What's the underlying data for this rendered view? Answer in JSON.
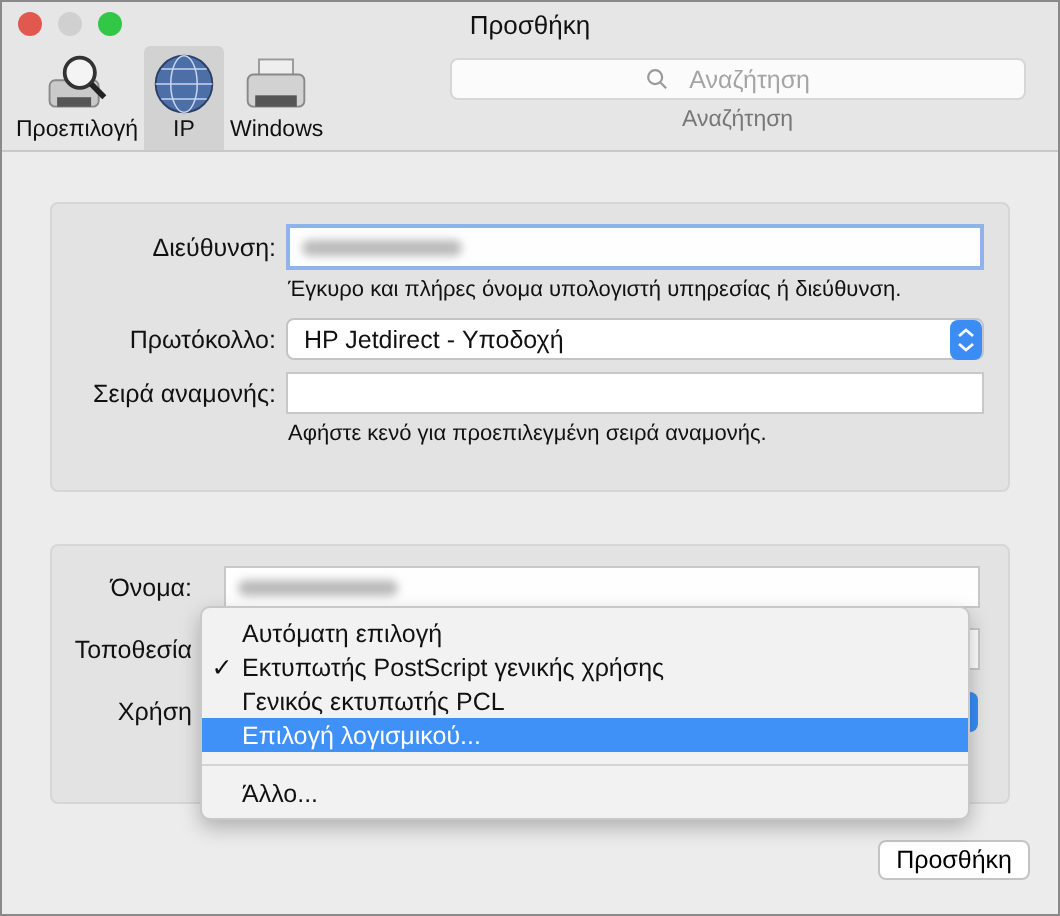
{
  "window": {
    "title": "Προσθήκη"
  },
  "toolbar": {
    "tabs": [
      {
        "label": "Προεπιλογή",
        "kind": "default",
        "selected": false
      },
      {
        "label": "IP",
        "kind": "ip",
        "selected": true
      },
      {
        "label": "Windows",
        "kind": "windows",
        "selected": false
      }
    ],
    "search": {
      "placeholder": "Αναζήτηση",
      "label": "Αναζήτηση"
    }
  },
  "connection": {
    "rows": [
      {
        "kind": "field",
        "label": "Διεύθυνση:",
        "focused": true,
        "value_blurred": true,
        "hint": "Έγκυρο και πλήρες όνομα υπολογιστή υπηρεσίας ή διεύθυνση."
      },
      {
        "kind": "select",
        "label": "Πρωτόκολλο:",
        "value": "HP Jetdirect - Υποδοχή"
      },
      {
        "kind": "field",
        "label": "Σειρά αναμονής:",
        "focused": false,
        "value_blurred": false,
        "hint": "Αφήστε κενό για προεπιλεγμένη σειρά αναμονής."
      }
    ]
  },
  "printer": {
    "rows": [
      {
        "kind": "field",
        "label": "Όνομα:",
        "focused": false,
        "value_blurred": true
      },
      {
        "kind": "field",
        "label": "Τοποθεσία",
        "focused": false
      },
      {
        "kind": "select",
        "label": "Χρήση"
      }
    ]
  },
  "use_menu": {
    "items": [
      {
        "kind": "item",
        "label": "Αυτόματη επιλογή",
        "checked": false,
        "selected": false
      },
      {
        "kind": "item",
        "label": "Εκτυπωτής PostScript γενικής χρήσης",
        "checked": true,
        "selected": false
      },
      {
        "kind": "item",
        "label": "Γενικός εκτυπωτής PCL",
        "checked": false,
        "selected": false
      },
      {
        "kind": "item",
        "label": "Επιλογή λογισμικού...",
        "checked": false,
        "selected": true
      },
      {
        "kind": "separator"
      },
      {
        "kind": "item",
        "label": "Άλλο...",
        "checked": false,
        "selected": false
      }
    ],
    "check_mark": "✓"
  },
  "buttons": [
    "Προσθήκη"
  ]
}
